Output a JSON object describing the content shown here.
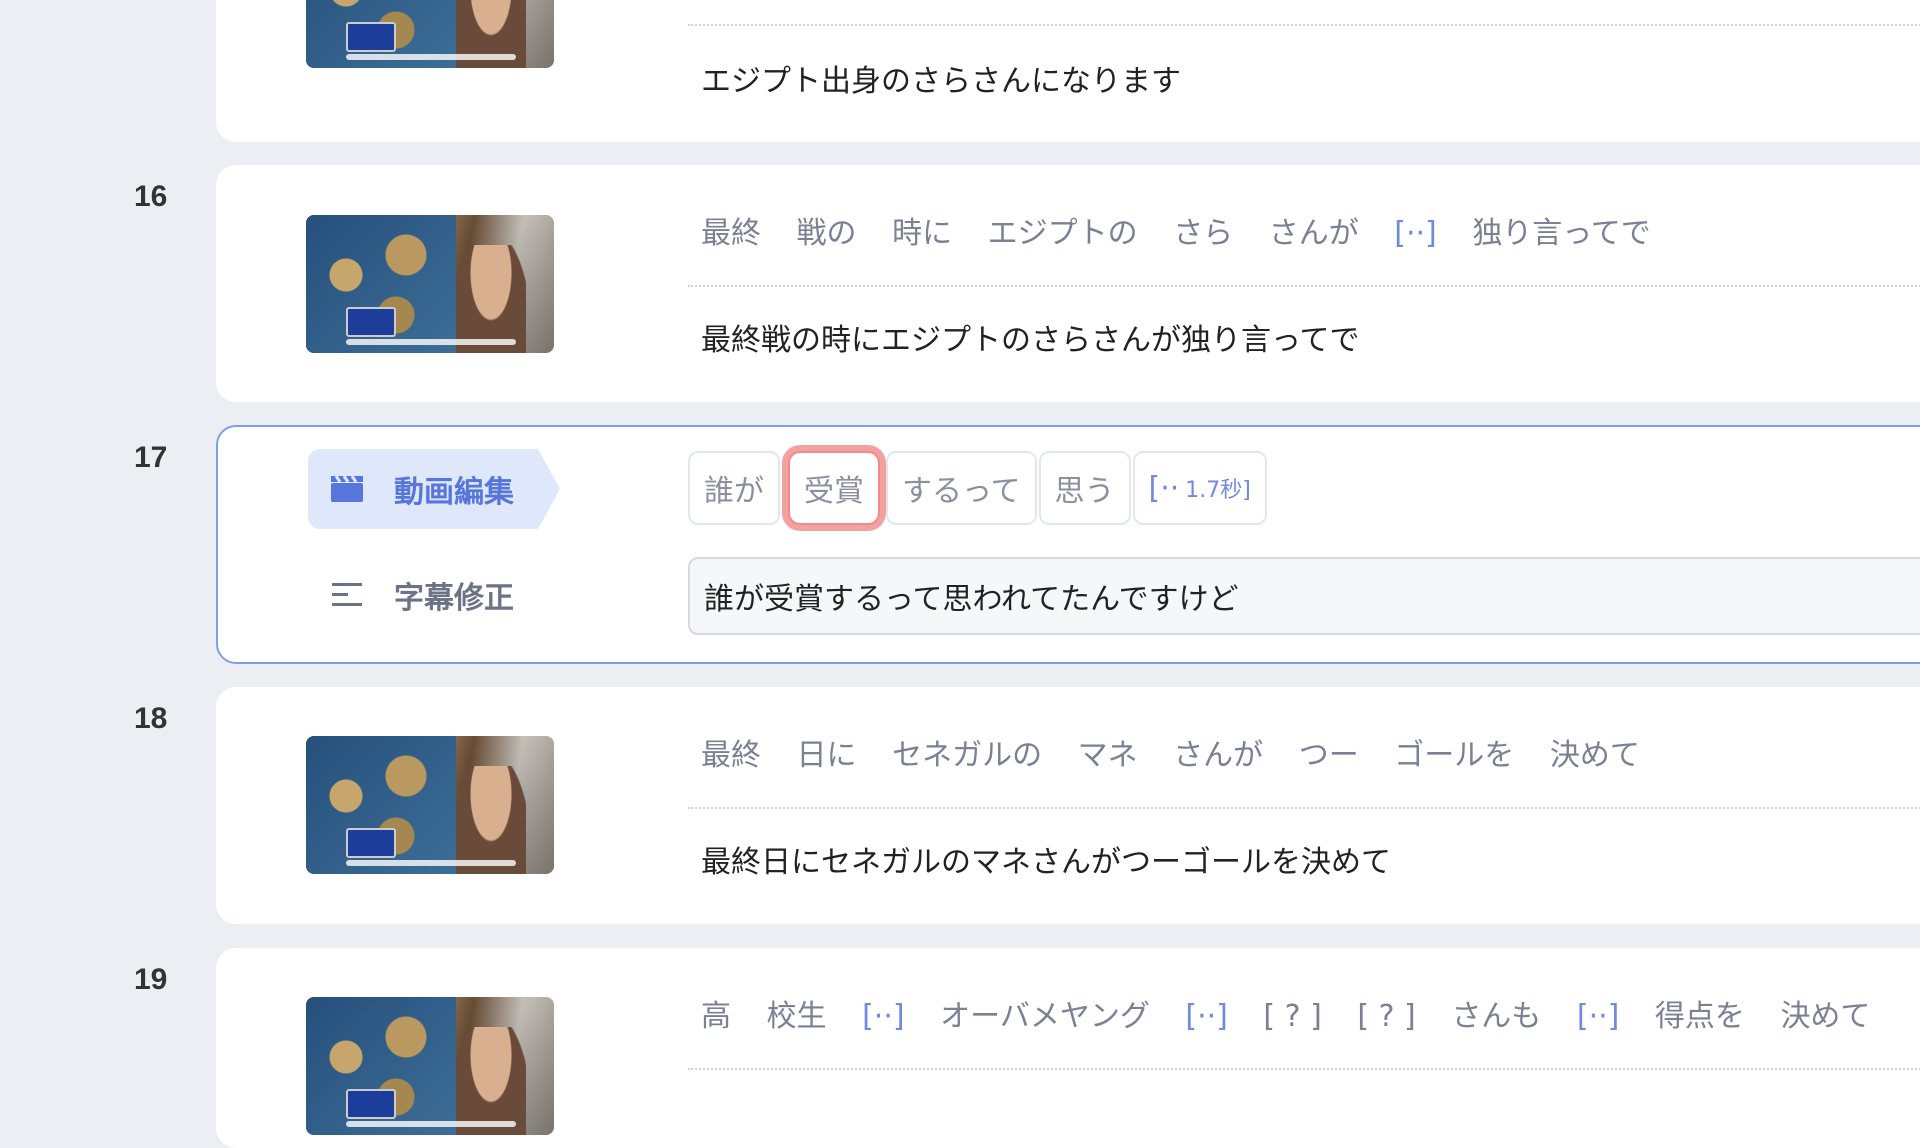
{
  "rows": [
    {
      "number": "",
      "tokens": [],
      "text": "エジプト出身のさらさんになります"
    },
    {
      "number": "16",
      "tokens": [
        "最終",
        "戦の",
        "時に",
        "エジプトの",
        "さら",
        "さんが",
        "[··]",
        "独り言ってで"
      ],
      "text": "最終戦の時にエジプトのさらさんが独り言ってで"
    },
    {
      "number": "17",
      "tabs": {
        "video_edit": "動画編集",
        "subtitle_fix": "字幕修正"
      },
      "chips": [
        "誰が",
        "受賞",
        "するって",
        "思う"
      ],
      "gap_chip": {
        "mark": "[··",
        "duration": "1.7秒]"
      },
      "edit_value": "誰が受賞するって思われてたんですけど"
    },
    {
      "number": "18",
      "tokens": [
        "最終",
        "日に",
        "セネガルの",
        "マネ",
        "さんが",
        "つー",
        "ゴールを",
        "決めて"
      ],
      "text": "最終日にセネガルのマネさんがつーゴールを決めて"
    },
    {
      "number": "19",
      "tokens": [
        "高",
        "校生",
        "[··]",
        "オーバメヤング",
        "[··]",
        "[ ? ]",
        "[ ? ]",
        "さんも",
        "[··]",
        "得点を",
        "決めて"
      ],
      "text": ""
    }
  ],
  "icons": {
    "video": "clapperboard-icon",
    "subtitle": "subtitle-lines-icon"
  },
  "colors": {
    "accent": "#5676dc",
    "selection": "#f08b8b"
  }
}
